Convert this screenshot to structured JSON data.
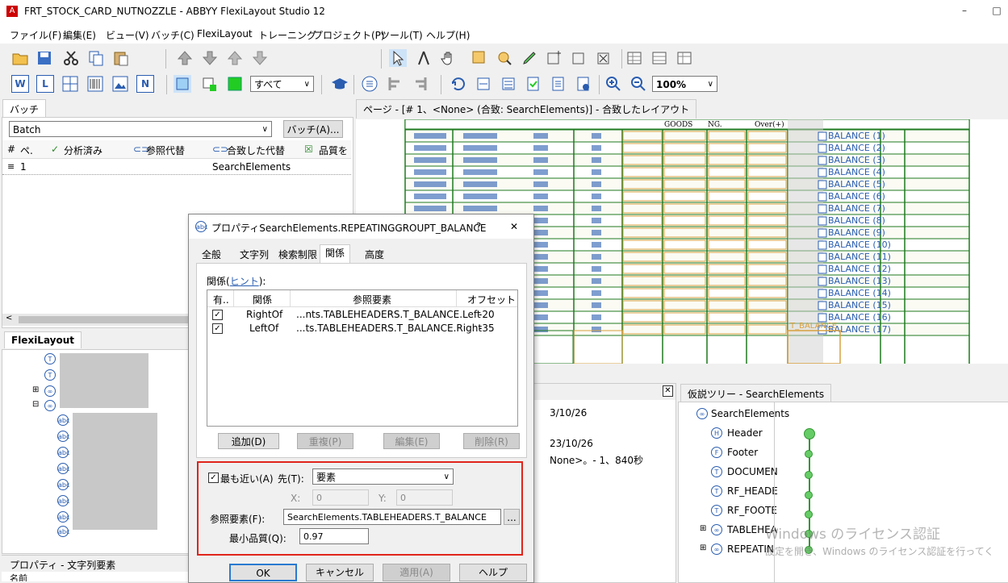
{
  "window": {
    "title": "FRT_STOCK_CARD_NUTNOZZLE - ABBYY FlexiLayout Studio 12",
    "app_icon": "app-icon",
    "minimize": "–",
    "maximize": "□"
  },
  "menu": [
    "ファイル(F)",
    "編集(E)",
    "ビュー(V)",
    "バッチ(C)",
    "FlexiLayout",
    "トレーニング",
    "プロジェクト(P)",
    "ツール(T)",
    "ヘルプ(H)"
  ],
  "toolbar2": {
    "filter_value": "すべて",
    "zoom_value": "100%",
    "btn_w": "W",
    "btn_l": "L",
    "btn_n": "N"
  },
  "batch_panel": {
    "tab": "バッチ",
    "combo_value": "Batch",
    "batch_button": "バッチ(A)...",
    "columns": [
      "#",
      "ペ.",
      "分析済み",
      "参照代替",
      "合致した代替",
      "品質を"
    ],
    "rows": [
      {
        "num": "1",
        "value": "SearchElements"
      }
    ]
  },
  "flexi_panel": {
    "tab": "FlexiLayout"
  },
  "props_panel": {
    "tab": "プロパティ - 文字列要素",
    "first_row": "名前"
  },
  "page_panel": {
    "tab": "ページ - [# 1、<None> (合致: SearchElements)] - 合致したレイアウト"
  },
  "page_canvas": {
    "headers": [
      "GOODS",
      "NG.",
      "Over(+)"
    ],
    "balance_labels": [
      "BALANCE (1)",
      "BALANCE (2)",
      "BALANCE (3)",
      "BALANCE (4)",
      "BALANCE (5)",
      "BALANCE (6)",
      "BALANCE (7)",
      "BALANCE (8)",
      "BALANCE (9)",
      "BALANCE (10)",
      "BALANCE (11)",
      "BALANCE (12)",
      "BALANCE (13)",
      "BALANCE (14)",
      "BALANCE (15)",
      "BALANCE (16)",
      "BALANCE (17)"
    ],
    "group_label": "T_BALANCE"
  },
  "log_panel": {
    "lines": [
      "3/10/26",
      "23/10/26",
      "None>。- 1、840秒"
    ]
  },
  "hypothesis_panel": {
    "tab": "仮説ツリー - SearchElements",
    "items": [
      "SearchElements",
      "Header",
      "Footer",
      "DOCUMEN",
      "RF_HEADE",
      "RF_FOOTE",
      "TABLEHEA",
      "REPEATIN"
    ]
  },
  "watermark": {
    "line1": "Windows のライセンス認証",
    "line2": "設定を開き、Windows のライセンス認証を行ってく"
  },
  "dialog": {
    "title": "プロパティSearchElements.REPEATINGGROUPT_BALANCE",
    "help": "?",
    "close": "✕",
    "tabs": [
      "全般",
      "文字列",
      "検索制限",
      "関係",
      "高度"
    ],
    "relations_label": "関係(",
    "relations_hint": "ヒント",
    "relations_suffix": "):",
    "columns": [
      "有..",
      "関係",
      "参照要素",
      "オフセット"
    ],
    "rows": [
      {
        "enabled": true,
        "relation": "RightOf",
        "ref": "...nts.TABLEHEADERS.T_BALANCE.Left",
        "offset": "-20"
      },
      {
        "enabled": true,
        "relation": "LeftOf",
        "ref": "...ts.TABLEHEADERS.T_BALANCE.Right",
        "offset": "-35"
      }
    ],
    "buttons": {
      "add": "追加(D)",
      "dup": "重複(P)",
      "edit": "編集(E)",
      "delete": "削除(R)"
    },
    "nearest": {
      "label": "最も近い(A)",
      "checked": true,
      "dest_label": "先(T):",
      "dest_value": "要素",
      "x_label": "X:",
      "x_value": "0",
      "y_label": "Y:",
      "y_value": "0"
    },
    "ref_label": "参照要素(F):",
    "ref_value": "SearchElements.TABLEHEADERS.T_BALANCE",
    "browse": "...",
    "minq_label": "最小品質(Q):",
    "minq_value": "0.97",
    "footer": {
      "ok": "OK",
      "cancel": "キャンセル",
      "apply": "適用(A)",
      "help": "ヘルプ"
    },
    "highlight_color": "#e0241b"
  }
}
